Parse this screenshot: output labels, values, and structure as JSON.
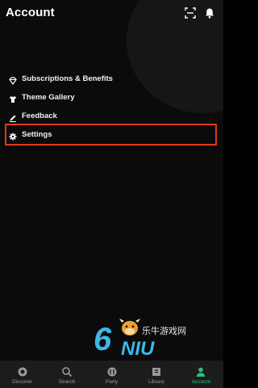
{
  "header": {
    "title": "Account",
    "icons": [
      "scan-icon",
      "bell-icon"
    ]
  },
  "menu": {
    "items": [
      {
        "label": "Subscriptions & Benefits",
        "icon": "diamond-icon"
      },
      {
        "label": "Theme Gallery",
        "icon": "shirt-icon"
      },
      {
        "label": "Feedback",
        "icon": "pencil-icon"
      },
      {
        "label": "Settings",
        "icon": "gear-icon"
      }
    ],
    "highlighted": "Settings"
  },
  "watermark": {
    "text_a": "6",
    "text_b": "NIU",
    "text_cn": "乐牛游戏网"
  },
  "tabbar": {
    "tabs": [
      {
        "label": "Discover",
        "icon": "discover-icon"
      },
      {
        "label": "Search",
        "icon": "search-icon"
      },
      {
        "label": "Party",
        "icon": "party-icon"
      },
      {
        "label": "Library",
        "icon": "library-icon"
      },
      {
        "label": "Account",
        "icon": "account-icon",
        "active": true
      }
    ]
  },
  "colors": {
    "accent": "#26c281",
    "highlight_box": "#e03a17",
    "background": "#0b0b0b"
  }
}
